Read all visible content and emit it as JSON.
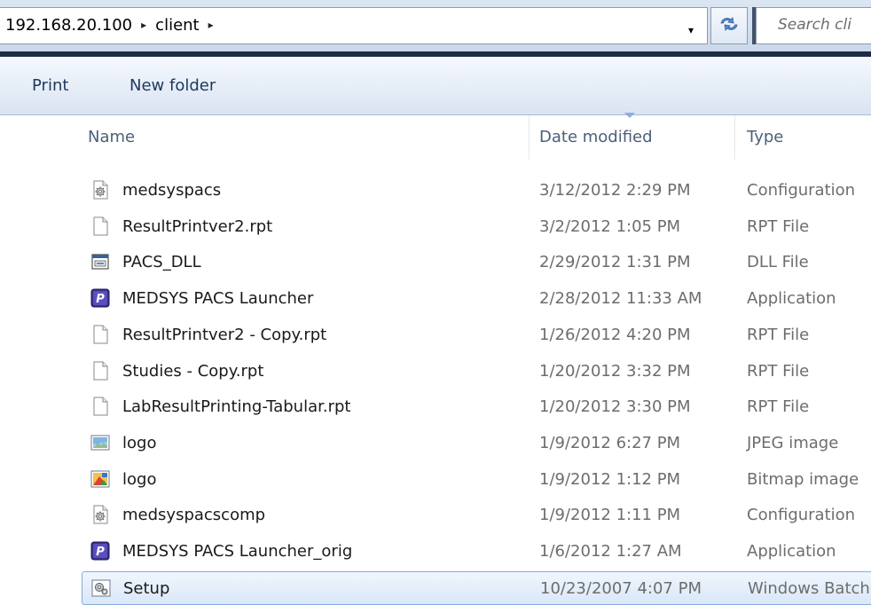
{
  "address": {
    "crumbs": [
      "192.168.20.100",
      "client"
    ],
    "separator": "▸",
    "dropdown_glyph": "▾",
    "refresh_icon": "refresh-icon"
  },
  "search": {
    "placeholder": "Search cli"
  },
  "commandbar": {
    "print_label": "Print",
    "new_folder_label": "New folder"
  },
  "columns": {
    "name": "Name",
    "date": "Date modified",
    "type": "Type"
  },
  "files": [
    {
      "name": "medsyspacs",
      "date": "3/12/2012 2:29 PM",
      "type": "Configuration",
      "icon": "config-file-icon"
    },
    {
      "name": "ResultPrintver2.rpt",
      "date": "3/2/2012 1:05 PM",
      "type": "RPT File",
      "icon": "blank-file-icon"
    },
    {
      "name": "PACS_DLL",
      "date": "2/29/2012 1:31 PM",
      "type": "DLL File",
      "icon": "dll-file-icon"
    },
    {
      "name": "MEDSYS PACS Launcher",
      "date": "2/28/2012 11:33 AM",
      "type": "Application",
      "icon": "app-p-icon"
    },
    {
      "name": "ResultPrintver2 - Copy.rpt",
      "date": "1/26/2012 4:20 PM",
      "type": "RPT File",
      "icon": "blank-file-icon"
    },
    {
      "name": "Studies - Copy.rpt",
      "date": "1/20/2012 3:32 PM",
      "type": "RPT File",
      "icon": "blank-file-icon"
    },
    {
      "name": "LabResultPrinting-Tabular.rpt",
      "date": "1/20/2012 3:30 PM",
      "type": "RPT File",
      "icon": "blank-file-icon"
    },
    {
      "name": "logo",
      "date": "1/9/2012 6:27 PM",
      "type": "JPEG image",
      "icon": "jpeg-image-icon"
    },
    {
      "name": "logo",
      "date": "1/9/2012 1:12 PM",
      "type": "Bitmap image",
      "icon": "bitmap-image-icon"
    },
    {
      "name": "medsyspacscomp",
      "date": "1/9/2012 1:11 PM",
      "type": "Configuration",
      "icon": "config-file-icon"
    },
    {
      "name": "MEDSYS PACS Launcher_orig",
      "date": "1/6/2012 1:27 AM",
      "type": "Application",
      "icon": "app-p-icon"
    },
    {
      "name": "Setup",
      "date": "10/23/2007 4:07 PM",
      "type": "Windows Batch File",
      "icon": "batch-file-icon"
    }
  ],
  "selected_index": 11,
  "colors": {
    "selection_border": "#84acdd",
    "selection_fill": "#d9e7f8",
    "command_text": "#1e395b",
    "secondary_text": "#6d6d6d"
  }
}
